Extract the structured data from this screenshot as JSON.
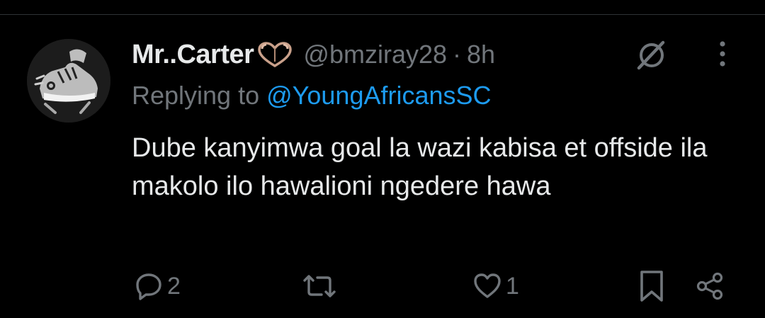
{
  "tweet": {
    "display_name": "Mr..Carter",
    "name_emoji": "heart-hands-emoji",
    "handle": "@bmziray28",
    "separator": "·",
    "time": "8h",
    "replying_prefix": "Replying to",
    "replying_to": "@YoungAfricansSC",
    "text": "Dube kanyimwa goal la wazi kabisa et offside ila makolo ilo hawalioni ngedere hawa"
  },
  "actions": {
    "replies": "2",
    "reposts": "",
    "likes": "1"
  },
  "icons": {
    "grok": "grok-icon",
    "more": "more-vertical-icon",
    "reply": "reply-icon",
    "repost": "repost-icon",
    "like": "heart-icon",
    "bookmark": "bookmark-icon",
    "share": "share-icon"
  },
  "colors": {
    "background": "#000000",
    "text_primary": "#e7e9ea",
    "text_secondary": "#71767b",
    "link": "#1d9bf0",
    "divider": "#2f3336"
  }
}
